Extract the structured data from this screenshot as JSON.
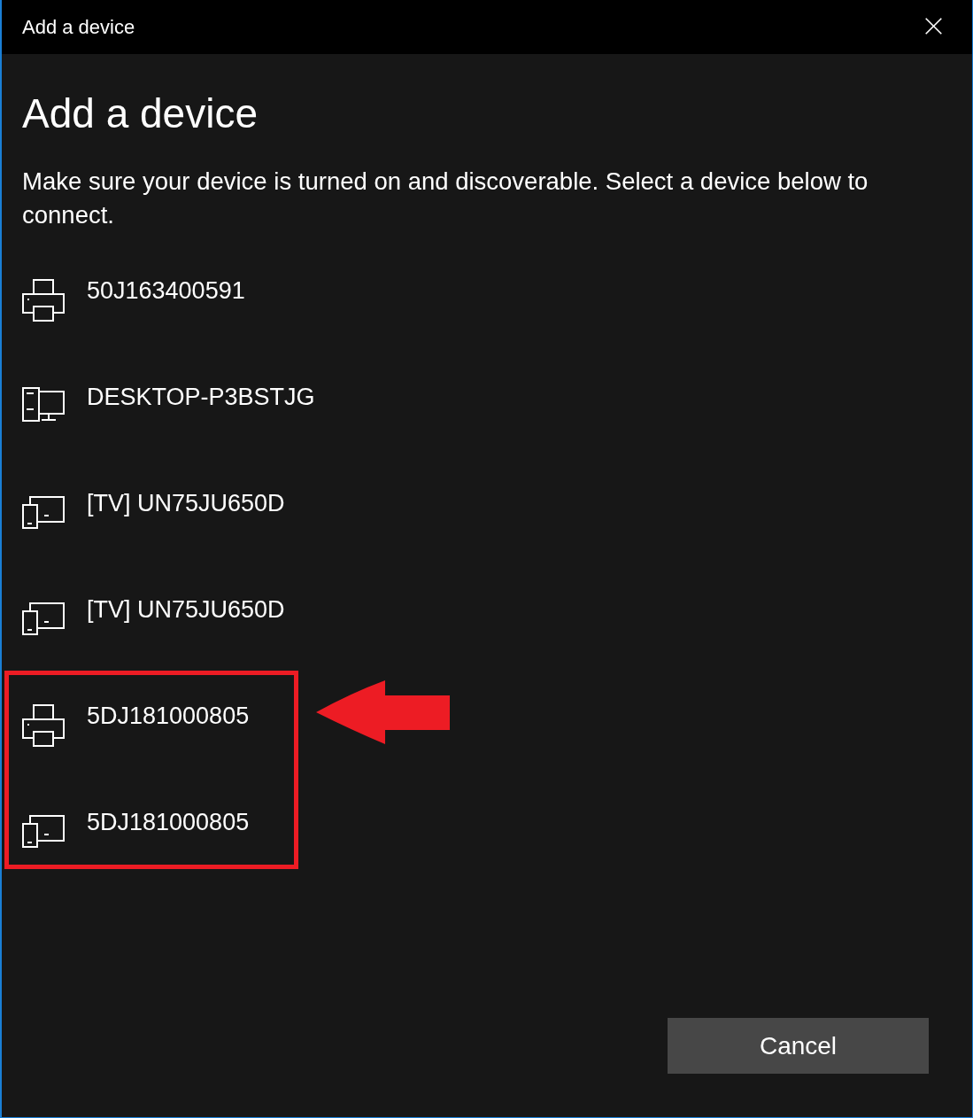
{
  "window": {
    "title": "Add a device"
  },
  "heading": "Add a device",
  "instructions": "Make sure your device is turned on and discoverable. Select a device below to connect.",
  "devices": [
    {
      "kind": "printer",
      "name": "50J163400591",
      "highlighted": false
    },
    {
      "kind": "computer",
      "name": "DESKTOP-P3BSTJG",
      "highlighted": false
    },
    {
      "kind": "display",
      "name": "[TV] UN75JU650D",
      "highlighted": false
    },
    {
      "kind": "display",
      "name": "[TV] UN75JU650D",
      "highlighted": false
    },
    {
      "kind": "printer",
      "name": "5DJ181000805",
      "highlighted": true
    },
    {
      "kind": "display",
      "name": "5DJ181000805",
      "highlighted": true
    }
  ],
  "annotation_arrow": true,
  "buttons": [
    {
      "label": "Cancel"
    }
  ]
}
